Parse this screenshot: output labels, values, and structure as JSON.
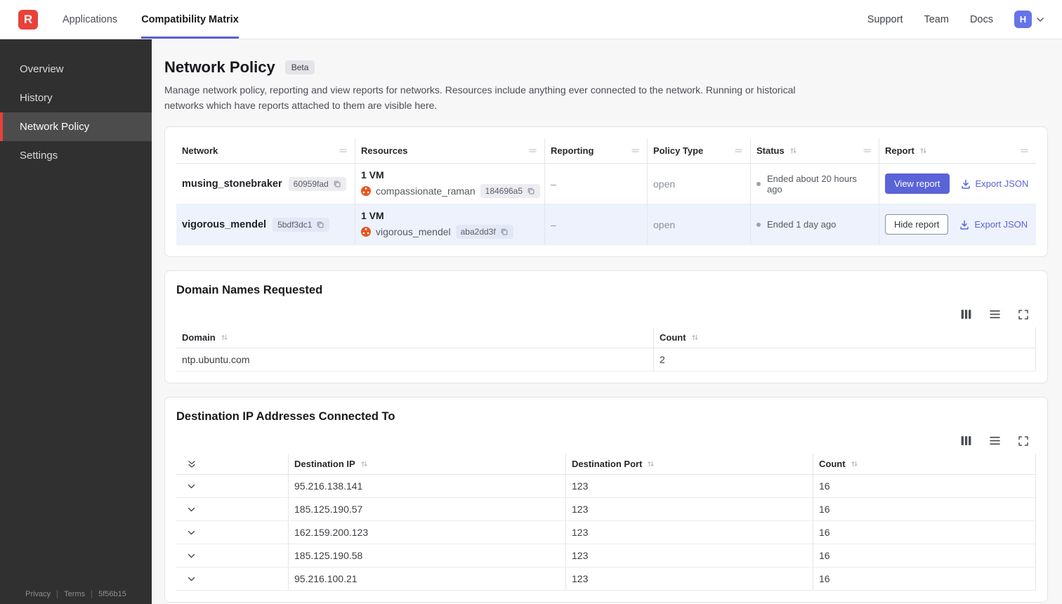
{
  "topbar": {
    "logo_text": "R",
    "nav": [
      {
        "label": "Applications"
      },
      {
        "label": "Compatibility Matrix"
      }
    ],
    "links": [
      {
        "label": "Support"
      },
      {
        "label": "Team"
      },
      {
        "label": "Docs"
      }
    ],
    "avatar_initial": "H"
  },
  "sidebar": {
    "items": [
      {
        "label": "Overview"
      },
      {
        "label": "History"
      },
      {
        "label": "Network Policy"
      },
      {
        "label": "Settings"
      }
    ],
    "footer": {
      "privacy": "Privacy",
      "terms": "Terms",
      "version": "5f56b15"
    }
  },
  "page": {
    "title": "Network Policy",
    "badge": "Beta",
    "description": "Manage network policy, reporting and view reports for networks. Resources include anything ever connected to the network. Running or historical networks which have reports attached to them are visible here."
  },
  "networks_table": {
    "columns": [
      "Network",
      "Resources",
      "Reporting",
      "Policy Type",
      "Status",
      "Report"
    ],
    "rows": [
      {
        "network_name": "musing_stonebraker",
        "network_id": "60959fad",
        "vm_count": "1 VM",
        "resource_name": "compassionate_raman",
        "resource_id": "184696a5",
        "reporting": "–",
        "policy_type": "open",
        "status": "Ended about 20 hours ago",
        "report_button": "View report",
        "export_label": "Export JSON"
      },
      {
        "network_name": "vigorous_mendel",
        "network_id": "5bdf3dc1",
        "vm_count": "1 VM",
        "resource_name": "vigorous_mendel",
        "resource_id": "aba2dd3f",
        "reporting": "–",
        "policy_type": "open",
        "status": "Ended 1 day ago",
        "report_button": "Hide report",
        "export_label": "Export JSON"
      }
    ]
  },
  "domains_table": {
    "title": "Domain Names Requested",
    "columns": [
      "Domain",
      "Count"
    ],
    "rows": [
      {
        "domain": "ntp.ubuntu.com",
        "count": 2
      }
    ]
  },
  "destinations_table": {
    "title": "Destination IP Addresses Connected To",
    "columns": [
      "Destination IP",
      "Destination Port",
      "Count"
    ],
    "rows": [
      {
        "ip": "95.216.138.141",
        "port": 123,
        "count": 16
      },
      {
        "ip": "185.125.190.57",
        "port": 123,
        "count": 16
      },
      {
        "ip": "162.159.200.123",
        "port": 123,
        "count": 16
      },
      {
        "ip": "185.125.190.58",
        "port": 123,
        "count": 16
      },
      {
        "ip": "95.216.100.21",
        "port": 123,
        "count": 16
      }
    ]
  },
  "colors": {
    "accent": "#5a63d8",
    "brand_red": "#e8413a",
    "highlight_row": "#edf2fd",
    "ubuntu_orange": "#e95420",
    "status_dot": "#9aa1ab"
  }
}
